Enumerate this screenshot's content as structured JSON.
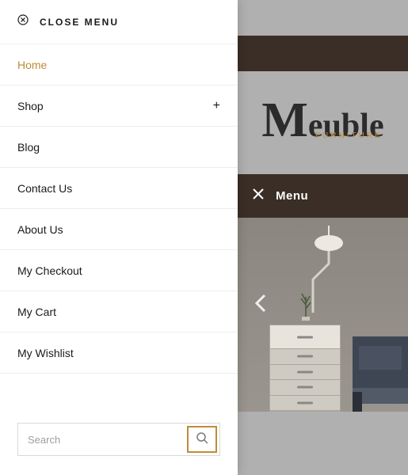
{
  "close_menu": {
    "label": "CLOSE MENU"
  },
  "menu": {
    "items": [
      {
        "label": "Home",
        "active": true,
        "expandable": false
      },
      {
        "label": "Shop",
        "active": false,
        "expandable": true
      },
      {
        "label": "Blog",
        "active": false,
        "expandable": false
      },
      {
        "label": "Contact Us",
        "active": false,
        "expandable": false
      },
      {
        "label": "About Us",
        "active": false,
        "expandable": false
      },
      {
        "label": "My Checkout",
        "active": false,
        "expandable": false
      },
      {
        "label": "My Cart",
        "active": false,
        "expandable": false
      },
      {
        "label": "My Wishlist",
        "active": false,
        "expandable": false
      }
    ]
  },
  "search": {
    "placeholder": "Search"
  },
  "backdrop": {
    "logo_main": "euble",
    "logo_sub": "FURNITURE",
    "menu_label": "Menu"
  },
  "icons": {
    "expand_plus": "+"
  }
}
